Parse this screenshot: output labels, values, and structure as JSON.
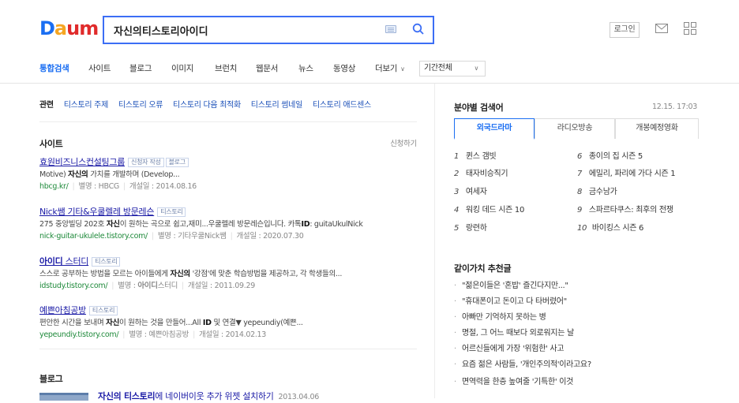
{
  "header": {
    "logo_text": {
      "d": "D",
      "a": "a",
      "u": "u",
      "m": "m"
    },
    "search_value": "자신의티스토리아이디",
    "login_label": "로그인"
  },
  "tabs": {
    "items": [
      "통합검색",
      "사이트",
      "블로그",
      "이미지",
      "브런치",
      "웹문서",
      "뉴스",
      "동영상"
    ],
    "more_label": "더보기",
    "period_label": "기간전체"
  },
  "related": {
    "label": "관련",
    "links": [
      "티스토리 주제",
      "티스토리 오류",
      "티스토리 다음 최적화",
      "티스토리 썸네일",
      "티스토리 애드센스"
    ]
  },
  "site_section": {
    "title": "사이트",
    "apply_label": "신청하기",
    "items": [
      {
        "title": "효원비즈니스컨설팅그룹",
        "badges": [
          "신청자 작성",
          "블로그"
        ],
        "desc_a": "Motive) ",
        "desc_b": "자신의",
        "desc_c": " 가치를 개발하며 (Develop...",
        "url": "hbcg.kr/",
        "meta1": "별명 : HBCG",
        "meta2": "개설일 : 2014.08.16"
      },
      {
        "title": "Nick쌤 기타&우쿨렐레 방문레슨",
        "badges": [
          "티스토리"
        ],
        "desc_a": "275 중앙빌딩 202호 ",
        "desc_b": "자신",
        "desc_c": "이 원하는 곡으로 쉽고,재미...우쿨렐레 방문레슨입니다. 카톡",
        "desc_d": "ID",
        "desc_e": ": guitaUkulNick",
        "url": "nick-guitar-ukulele.tistory.com/",
        "meta1": "별명 : 기타우쿨Nick쌤",
        "meta2": "개설일 : 2020.07.30"
      },
      {
        "title_a": "아이디",
        "title_b": " 스터디",
        "badges": [
          "티스토리"
        ],
        "desc_a": "스스로 공부하는 방법을 모르는 아이들에게 ",
        "desc_b": "자신의",
        "desc_c": " '강점'에 맞춘 학습방법을 제공하고, 각 학생들의...",
        "url": "idstudy.tistory.com/",
        "meta1_a": "별명 : ",
        "meta1_b": "아이디",
        "meta1_c": "스터디",
        "meta2": "개설일 : 2011.09.29"
      },
      {
        "title": "예쁜아침공방",
        "badges": [
          "티스토리"
        ],
        "desc_a": "편안한 시간을 보내며 ",
        "desc_b": "자신",
        "desc_c": "이 원하는 것을 만들어...All ",
        "desc_d": "ID",
        "desc_e": " 및 연결▼ yepeundiy(예쁜...",
        "url": "yepeundiy.tistory.com/",
        "meta1": "별명 : 예쁜아침공방",
        "meta2": "개설일 : 2014.02.13"
      }
    ]
  },
  "blog_section": {
    "title": "블로그",
    "first_title_a": "자신의 티스토리",
    "first_title_b": "에 네이버이웃 추가 위젯 설치하기",
    "first_date": "2013.04.06"
  },
  "right": {
    "category_title": "분야별 검색어",
    "time": "12.15. 17:03",
    "tabs": [
      "외국드라마",
      "라디오방송",
      "개봉예정영화"
    ],
    "active_tab": 0,
    "ranks": [
      {
        "n": "1",
        "t": "퀸스 갬빗"
      },
      {
        "n": "2",
        "t": "태자비승직기"
      },
      {
        "n": "3",
        "t": "여세자"
      },
      {
        "n": "4",
        "t": "워킹 데드 시즌 10"
      },
      {
        "n": "5",
        "t": "랑련하"
      },
      {
        "n": "6",
        "t": "종이의 집 시즌 5"
      },
      {
        "n": "7",
        "t": "에밀리, 파리에 가다 시즌 1"
      },
      {
        "n": "8",
        "t": "금수남가"
      },
      {
        "n": "9",
        "t": "스파르타쿠스: 최후의 전쟁"
      },
      {
        "n": "10",
        "t": "바이킹스 시즌 6"
      }
    ],
    "rec_title": "같이가치 추천글",
    "recs": [
      "\"젊은이들은 '혼밥' 즐긴다지만...\"",
      "\"휴대폰이고 돈이고 다 타버렸어\"",
      "아빠만 기억하지 못하는 병",
      "명절, 그 어느 때보다 외로워지는 날",
      "어르신들에게 가장 '위험한' 사고",
      "요즘 젊은 사람들, '개인주의적'이라고요?",
      "면역력을 한층 높여줄 '기특한' 이것"
    ]
  },
  "colors": {
    "accent": "#1a6ef2",
    "link": "#1a1aa6",
    "url": "#1f8a3b"
  }
}
